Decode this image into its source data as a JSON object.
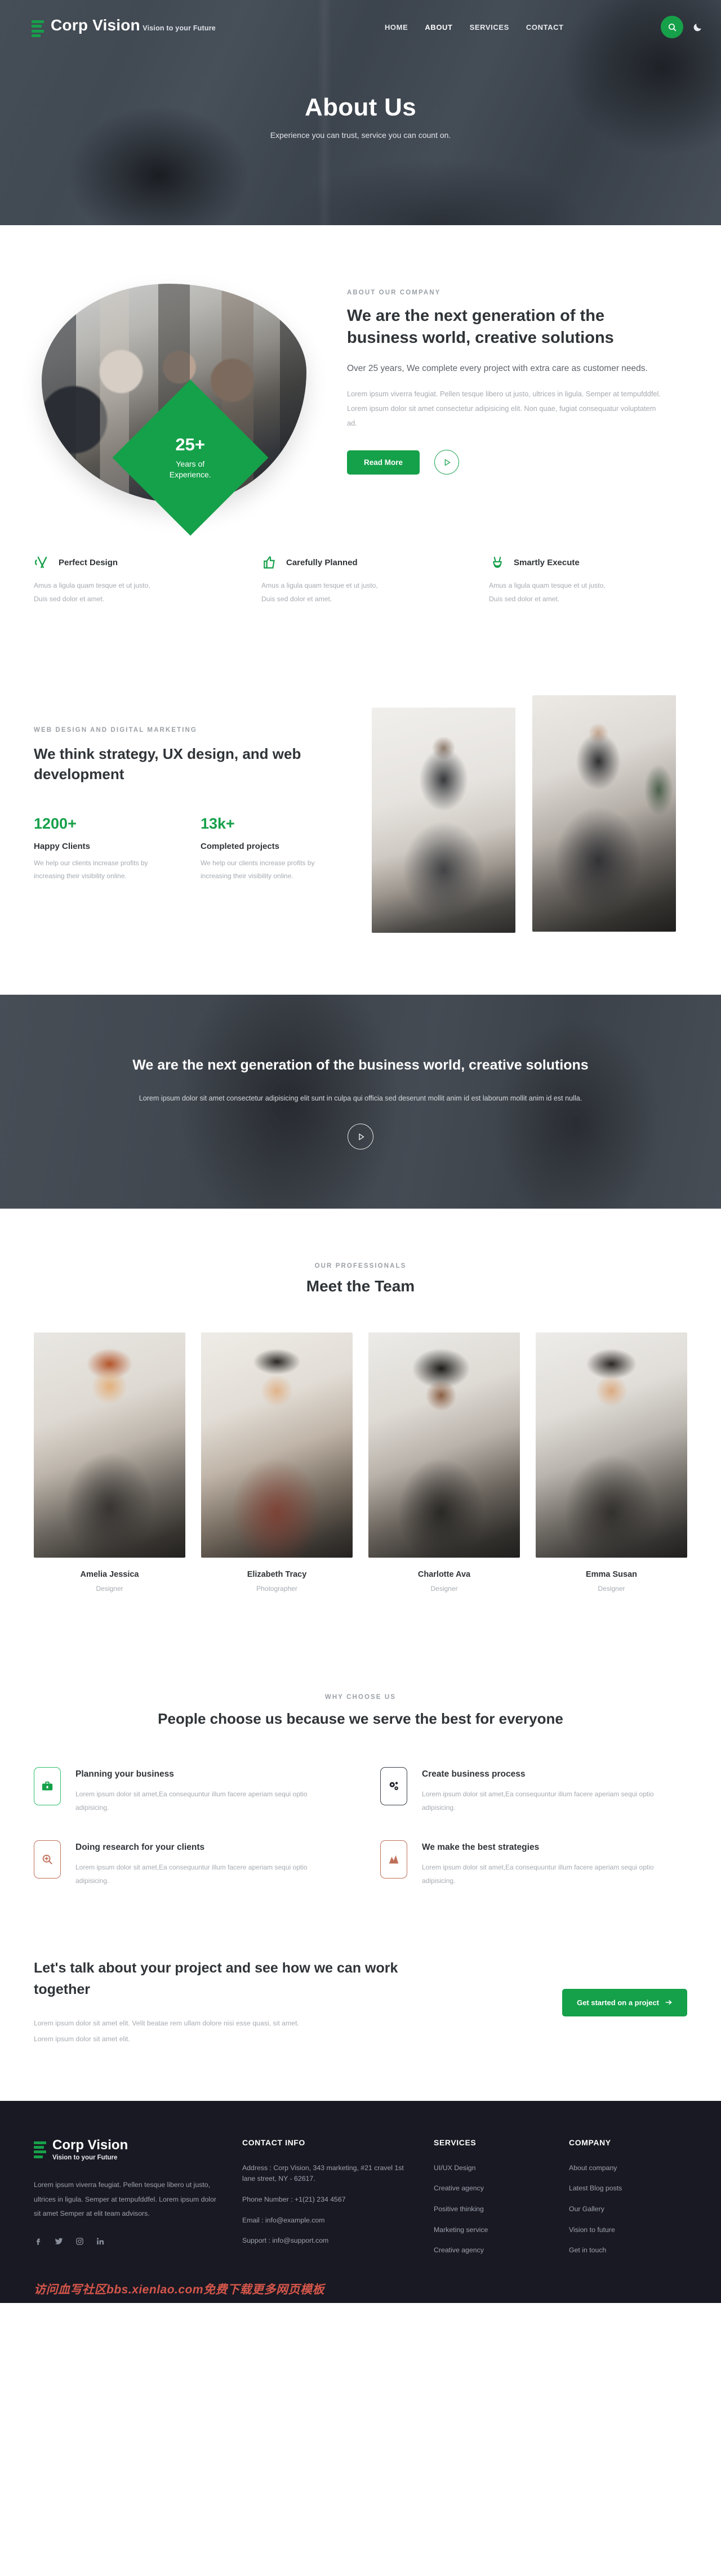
{
  "header": {
    "brand_name": "Corp Vision",
    "brand_tagline": "Vision to your Future",
    "nav": [
      {
        "label": "HOME",
        "active": false
      },
      {
        "label": "ABOUT",
        "active": true
      },
      {
        "label": "SERVICES",
        "active": false
      },
      {
        "label": "CONTACT",
        "active": false
      }
    ],
    "search_icon": "search-icon",
    "theme_icon": "moon-icon"
  },
  "hero": {
    "title": "About Us",
    "subtitle": "Experience you can trust, service you can count on."
  },
  "about": {
    "eyebrow": "ABOUT OUR COMPANY",
    "heading": "We are the next generation of the business world, creative solutions",
    "lead": "Over 25 years, We complete every project with extra care as customer needs.",
    "paragraph": "Lorem ipsum viverra feugiat. Pellen tesque libero ut justo, ultrices in ligula. Semper at tempufddfel. Lorem ipsum dolor sit amet consectetur adipisicing elit. Non quae, fugiat consequatur voluptatem ad.",
    "button": "Read More",
    "play_icon": "play-icon",
    "badge_number": "25+",
    "badge_label_1": "Years of",
    "badge_label_2": "Experience."
  },
  "features": [
    {
      "icon": "scissors-icon",
      "title": "Perfect Design",
      "text": "Amus a ligula quam tesque et ut justo, Duis sed dolor et amet."
    },
    {
      "icon": "thumbs-up-icon",
      "title": "Carefully Planned",
      "text": "Amus a ligula quam tesque et ut justo, Duis sed dolor et amet."
    },
    {
      "icon": "peace-hand-icon",
      "title": "Smartly Execute",
      "text": "Amus a ligula quam tesque et ut justo, Duis sed dolor et amet."
    }
  ],
  "strategy": {
    "eyebrow": "WEB DESIGN AND DIGITAL MARKETING",
    "heading": "We think strategy, UX design, and web development",
    "stats": [
      {
        "number": "1200+",
        "label": "Happy Clients",
        "text": "We help our clients increase profits by increasing their visibility online."
      },
      {
        "number": "13k+",
        "label": "Completed projects",
        "text": "We help our clients increase profits by increasing their visibility online."
      }
    ]
  },
  "dark_cta": {
    "heading": "We are the next generation of the business world, creative solutions",
    "paragraph": "Lorem ipsum dolor sit amet consectetur adipisicing elit sunt in culpa qui officia sed deserunt mollit anim id est laborum mollit anim id est nulla.",
    "play_icon": "play-icon"
  },
  "team": {
    "eyebrow": "OUR PROFESSIONALS",
    "heading": "Meet the Team",
    "members": [
      {
        "name": "Amelia Jessica",
        "role": "Designer"
      },
      {
        "name": "Elizabeth Tracy",
        "role": "Photographer"
      },
      {
        "name": "Charlotte Ava",
        "role": "Designer"
      },
      {
        "name": "Emma Susan",
        "role": "Designer"
      }
    ]
  },
  "why": {
    "eyebrow": "WHY CHOOSE US",
    "heading": "People choose us because we serve the best for everyone",
    "cards": [
      {
        "icon": "briefcase-icon",
        "tone": "green",
        "title": "Planning your business",
        "text": "Lorem ipsum dolor sit amet,Ea consequuntur illum facere aperiam sequi optio adipisicing."
      },
      {
        "icon": "gears-icon",
        "tone": "dark",
        "title": "Create business process",
        "text": "Lorem ipsum dolor sit amet,Ea consequuntur illum facere aperiam sequi optio adipisicing."
      },
      {
        "icon": "magnifier-icon",
        "tone": "brown",
        "title": "Doing research for your clients",
        "text": "Lorem ipsum dolor sit amet,Ea consequuntur illum facere aperiam sequi optio adipisicing."
      },
      {
        "icon": "chart-icon",
        "tone": "brown",
        "title": "We make the best strategies",
        "text": "Lorem ipsum dolor sit amet,Ea consequuntur illum facere aperiam sequi optio adipisicing."
      }
    ]
  },
  "talk": {
    "heading": "Let's talk about your project and see how we can work together",
    "paragraph_1": "Lorem ipsum dolor sit amet elit. Velit beatae rem ullam dolore nisi esse quasi, sit amet.",
    "paragraph_2": "Lorem ipsum dolor sit amet elit.",
    "button": "Get started on a project",
    "button_icon": "arrow-right-icon"
  },
  "footer": {
    "brand_name": "Corp Vision",
    "brand_tagline": "Vision to your Future",
    "about": "Lorem ipsum viverra feugiat. Pellen tesque libero ut justo, ultrices in ligula. Semper at tempufddfel. Lorem ipsum dolor sit amet Semper at elit team advisors.",
    "socials": [
      "facebook-icon",
      "twitter-icon",
      "instagram-icon",
      "linkedin-icon"
    ],
    "contact": {
      "title": "CONTACT INFO",
      "lines": [
        "Address : Corp Vision, 343 marketing, #21 cravel 1st lane street, NY - 62617.",
        "Phone Number : +1(21) 234 4567",
        "Email : info@example.com",
        "Support : info@support.com"
      ]
    },
    "services": {
      "title": "SERVICES",
      "items": [
        "UI/UX Design",
        "Creative agency",
        "Positive thinking",
        "Marketing service",
        "Creative agency"
      ]
    },
    "company": {
      "title": "COMPANY",
      "items": [
        "About company",
        "Latest Blog posts",
        "Our Gallery",
        "Vision to future",
        "Get in touch"
      ]
    },
    "watermark": "访问血写社区bbs.xienlao.com免费下载更多网页模板"
  },
  "colors": {
    "accent": "#15a04a",
    "heading": "#2f3438",
    "muted": "#a6abb1",
    "footer_bg": "#191923",
    "watermark": "#d4564a"
  }
}
